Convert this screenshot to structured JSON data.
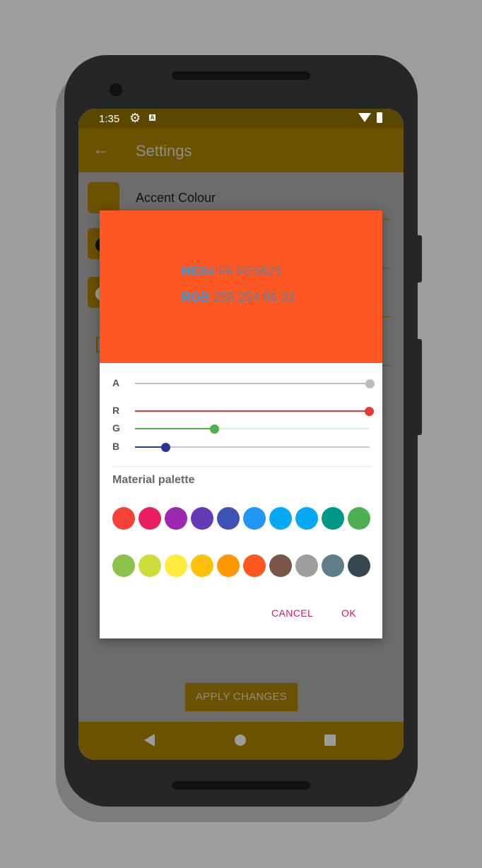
{
  "status_bar": {
    "time": "1:35",
    "icons": [
      "gear-icon",
      "a-icon",
      "wifi-icon",
      "battery-icon"
    ]
  },
  "app_bar": {
    "title": "Settings",
    "back_icon": "arrow-back-icon"
  },
  "settings": {
    "accent_colour_label": "Accent Colour"
  },
  "apply_button": "APPLY CHANGES",
  "dialog": {
    "preview_color": "#FF5722",
    "hex_label": "HEX#",
    "hex_value": "FF FE5621",
    "rgb_label": "RGB",
    "rgb_value": "255 254 86 33",
    "sliders": [
      {
        "label": "A",
        "value": 255,
        "color": "#bdbdbd"
      },
      {
        "label": "R",
        "value": 254,
        "color": "#e53935"
      },
      {
        "label": "G",
        "value": 86,
        "color": "#4caf50"
      },
      {
        "label": "B",
        "value": 33,
        "color": "#283593"
      }
    ],
    "palette_title": "Material palette",
    "palette_row1": [
      "#f44336",
      "#e91e63",
      "#9c27b0",
      "#673ab7",
      "#3f51b5",
      "#2196f3",
      "#03a9f4",
      "#03a9f4",
      "#009688",
      "#4caf50"
    ],
    "palette_row2": [
      "#8bc34a",
      "#cddc39",
      "#ffeb3b",
      "#ffc107",
      "#ff9800",
      "#ff5722",
      "#795548",
      "#9e9e9e",
      "#607d8b",
      "#37474f"
    ],
    "cancel_label": "CANCEL",
    "ok_label": "OK"
  },
  "colors": {
    "app_bar": "#6b5200",
    "status_bar": "#5a4800",
    "accent_button": "#d81b60"
  }
}
